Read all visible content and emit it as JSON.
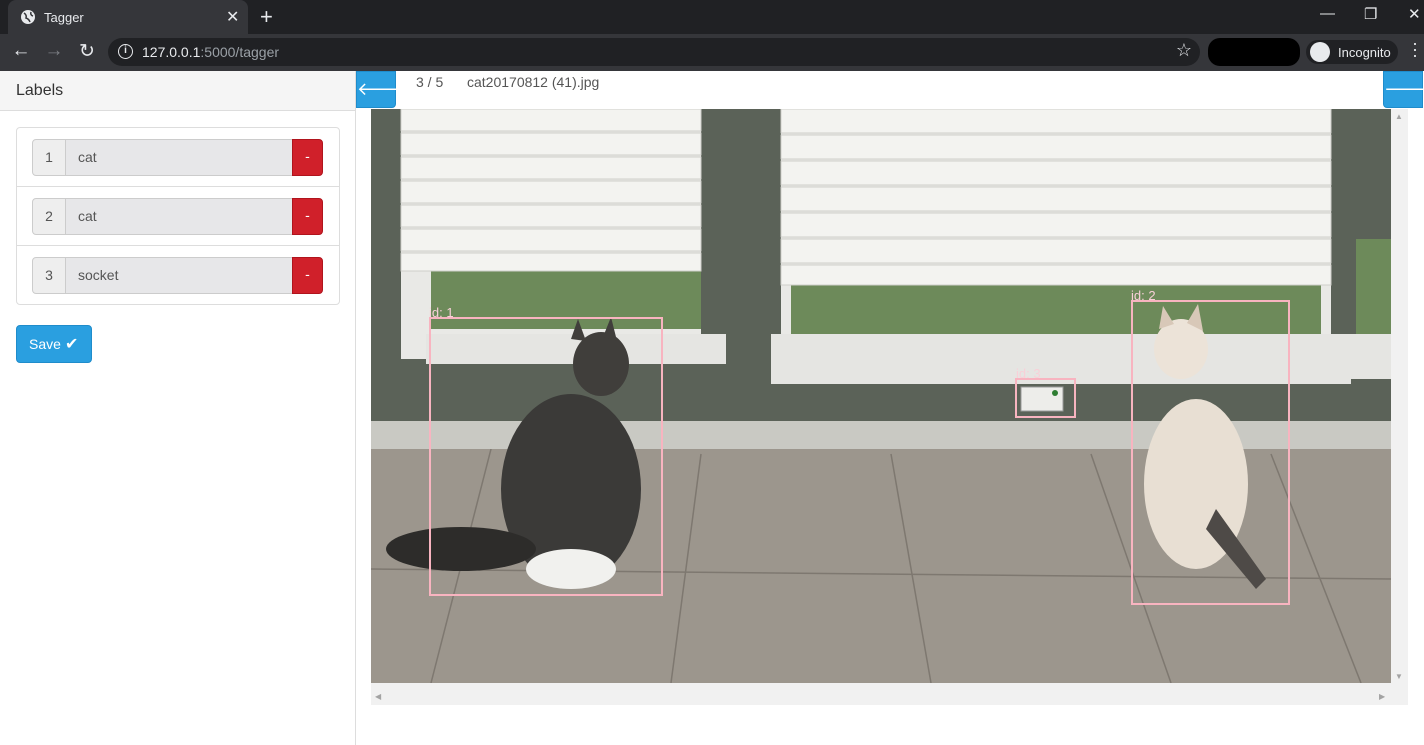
{
  "browser": {
    "tab_title": "Tagger",
    "url_host": "127.0.0.1",
    "url_rest": ":5000/tagger",
    "incognito_label": "Incognito",
    "icons": [
      "globe-icon",
      "close-icon",
      "plus-icon",
      "back-icon",
      "forward-icon",
      "reload-icon",
      "info-icon",
      "star-icon",
      "incognito-icon",
      "kebab-menu-icon"
    ]
  },
  "sidebar": {
    "title": "Labels",
    "labels": [
      {
        "id": "1",
        "name": "cat",
        "remove": "-"
      },
      {
        "id": "2",
        "name": "cat",
        "remove": "-"
      },
      {
        "id": "3",
        "name": "socket",
        "remove": "-"
      }
    ],
    "save_label": "Save"
  },
  "main": {
    "counter": "3 / 5",
    "filename": "cat20170812 (41).jpg",
    "boxes": [
      {
        "label": "id: 1"
      },
      {
        "label": "id: 2"
      },
      {
        "label": "id: 3"
      }
    ]
  },
  "colors": {
    "accent": "#2a9fe0",
    "danger": "#d0202a",
    "bbox": "#f8b4c0"
  }
}
